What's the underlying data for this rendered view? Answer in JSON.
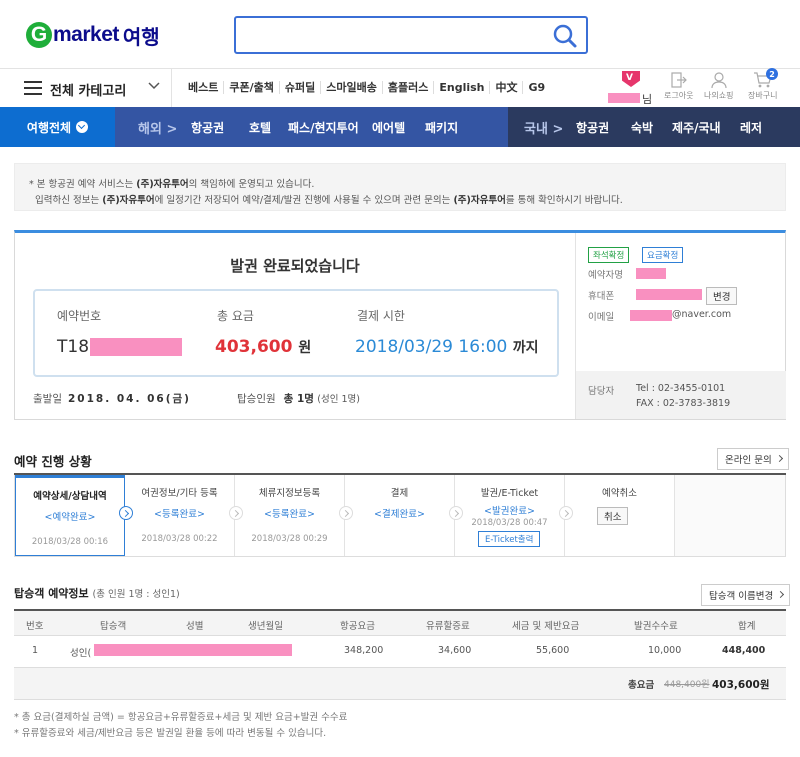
{
  "header": {
    "logo_g": "G",
    "logo_text": "market",
    "logo_suffix": "여행",
    "search_placeholder": ""
  },
  "gnb": {
    "category_label": "전체 카테고리",
    "links": [
      "베스트",
      "쿠폰/출책",
      "슈퍼딜",
      "스마일배송",
      "홈플러스",
      "English",
      "中文",
      "G9"
    ],
    "user_suffix": "님",
    "util": [
      "로그아웃",
      "나의쇼핑",
      "장바구니"
    ],
    "cart_count": "2"
  },
  "travel_bar": {
    "all_label": "여행전체",
    "overseas_label": "해외 >",
    "overseas_items": [
      "항공권",
      "호텔",
      "패스/현지투어",
      "에어텔",
      "패키지"
    ],
    "domestic_label": "국내 >",
    "domestic_items": [
      "항공권",
      "숙박",
      "제주/국내",
      "레저"
    ]
  },
  "notice": {
    "line1_a": "* 본 항공권 예약 서비스는 ",
    "line1_b": "(주)자유투어",
    "line1_c": "의 책임하에 운영되고 있습니다.",
    "line2_a": "입력하신 정보는 ",
    "line2_b": "(주)자유투어",
    "line2_c": "에 일정기간 저장되어 예약/결제/발권 진행에 사용될 수 있으며 관련 문의는 ",
    "line2_d": "(주)자유투어",
    "line2_e": "를 통해 확인하시기 바랍니다."
  },
  "result": {
    "title": "발권 완료되었습니다",
    "booking_label": "예약번호",
    "booking_value": "T18",
    "total_label": "총 요금",
    "total_value": "403,600",
    "total_unit": "원",
    "deadline_label": "결제 시한",
    "deadline_value": "2018/03/29 16:00",
    "deadline_suffix": "까지",
    "depart_label": "출발일",
    "depart_value": "2018. 04. 06(금)",
    "pax_label": "탑승인원",
    "pax_value": "총 1명",
    "pax_detail": "(성인 1명)",
    "badge_seat": "좌석확정",
    "badge_fare": "요금확정",
    "name_label": "예약자명",
    "phone_label": "휴대폰",
    "phone_button": "변경",
    "email_label": "이메일",
    "email_domain": "@naver.com",
    "agent_label": "담당자",
    "tel": "Tel : 02-3455-0101",
    "fax": "FAX : 02-3783-3819"
  },
  "progress": {
    "title": "예약 진행 상황",
    "inquiry_button": "온라인 문의",
    "steps": [
      {
        "name": "예약상세/상담내역",
        "status": "<예약완료>",
        "date": "2018/03/28 00:16"
      },
      {
        "name": "여권정보/기타 등록",
        "status": "<등록완료>",
        "date": "2018/03/28 00:22"
      },
      {
        "name": "체류지정보등록",
        "status": "<등록완료>",
        "date": "2018/03/28 00:29"
      },
      {
        "name": "결제",
        "status": "<결제완료>",
        "date": ""
      },
      {
        "name": "발권/E-Ticket",
        "status": "<발권완료>",
        "date": "2018/03/28 00:47",
        "button": "E-Ticket출력"
      },
      {
        "name": "예약취소",
        "status": "",
        "date": "",
        "button": "취소"
      }
    ]
  },
  "passengers": {
    "title": "탑승객 예약정보",
    "subtitle": "(총 인원 1명 : 성인1)",
    "rename_button": "탑승객 이름변경",
    "columns": [
      "번호",
      "탑승객",
      "성별",
      "생년월일",
      "항공요금",
      "유류할증료",
      "세금 및 제반요금",
      "발권수수료",
      "합계"
    ],
    "rows": [
      {
        "no": "1",
        "name": "성인(",
        "gender": "",
        "birth": "",
        "fare": "348,200",
        "fuel": "34,600",
        "tax": "55,600",
        "fee": "10,000",
        "sum": "448,400"
      }
    ],
    "total_label": "총요금",
    "total_strike": "448,400원",
    "total_final": "403,600원"
  },
  "footnotes": [
    "* 총 요금(결제하실 금액) = 항공요금+유류할증료+세금 및 제반 요금+발권 수수료",
    "* 유류할증료와 세금/제반요금 등은 발권일 환율 등에 따라 변동될 수 있습니다."
  ]
}
